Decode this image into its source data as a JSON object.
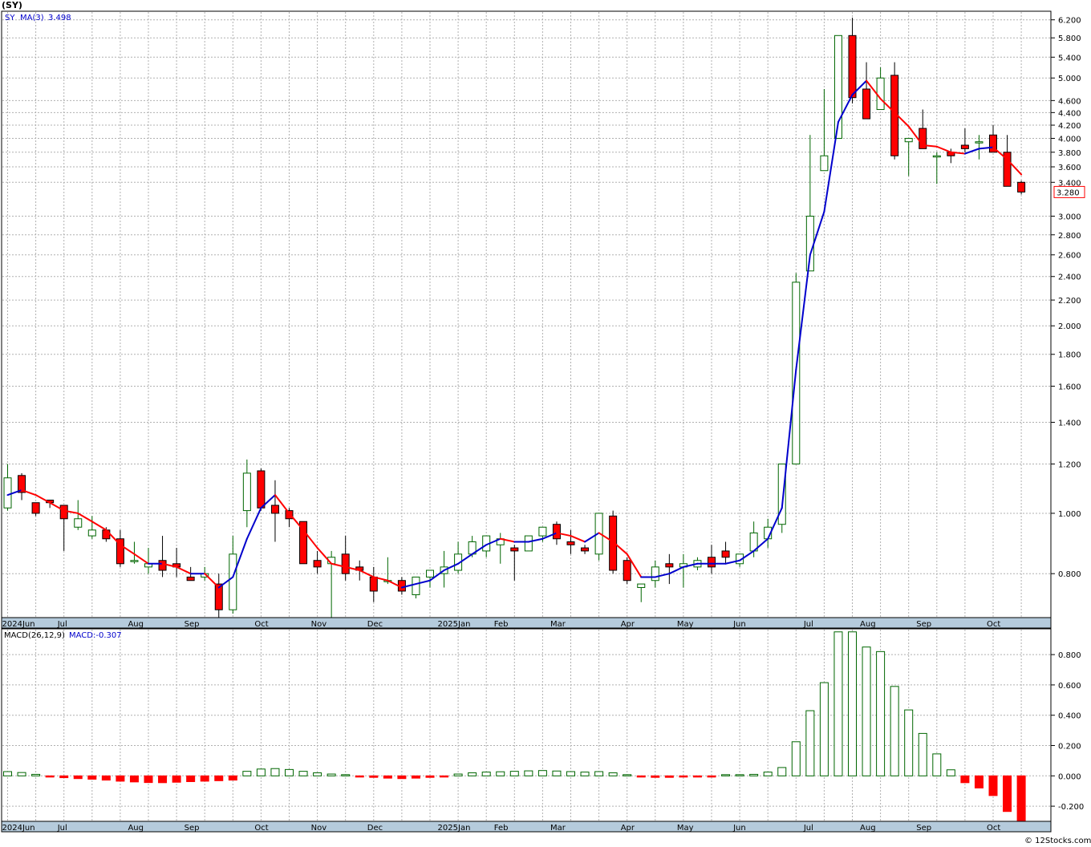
{
  "header": {
    "title": "(SY)"
  },
  "footer": {
    "credit": "© 12Stocks.com"
  },
  "colors": {
    "up": "#006600",
    "down": "#ff0000",
    "ma_up": "#0000cc",
    "ma_down": "#ff0000",
    "grid": "#b0b0b0",
    "axis_band": "#b5cbdc"
  },
  "price_panel": {
    "legend": {
      "symbol": "SY",
      "ma_label": "MA(3)",
      "ma_value": "3.498"
    },
    "last_price": "3.280"
  },
  "macd_panel": {
    "legend": {
      "label": "MACD(26,12,9)",
      "value_label": "MACD:-0.307"
    }
  },
  "x_axis": {
    "month_labels": [
      {
        "label": "2024Jun",
        "week": 0
      },
      {
        "label": "Jul",
        "week": 4
      },
      {
        "label": "Aug",
        "week": 9
      },
      {
        "label": "Sep",
        "week": 13
      },
      {
        "label": "Oct",
        "week": 18
      },
      {
        "label": "Nov",
        "week": 22
      },
      {
        "label": "Dec",
        "week": 26
      },
      {
        "label": "2025Jan",
        "week": 31
      },
      {
        "label": "Feb",
        "week": 35
      },
      {
        "label": "Mar",
        "week": 39
      },
      {
        "label": "Apr",
        "week": 44
      },
      {
        "label": "May",
        "week": 48
      },
      {
        "label": "Jun",
        "week": 52
      },
      {
        "label": "Jul",
        "week": 57
      },
      {
        "label": "Aug",
        "week": 61
      },
      {
        "label": "Sep",
        "week": 65
      },
      {
        "label": "Oct",
        "week": 70
      }
    ]
  },
  "chart_data": [
    {
      "type": "candlestick",
      "title": "(SY)",
      "y_scale": "log",
      "ylim": [
        0.68,
        6.4
      ],
      "y_ticks": [
        0.8,
        1.0,
        1.2,
        1.4,
        1.6,
        1.8,
        2.0,
        2.2,
        2.4,
        2.6,
        2.8,
        3.0,
        3.4,
        3.6,
        3.8,
        4.0,
        4.2,
        4.4,
        4.6,
        5.0,
        5.4,
        5.8,
        6.2
      ],
      "y_tick_labels": [
        "0.800",
        "1.000",
        "1.200",
        "1.400",
        "1.600",
        "1.800",
        "2.000",
        "2.200",
        "2.400",
        "2.600",
        "2.800",
        "3.000",
        "3.400",
        "3.600",
        "3.800",
        "4.000",
        "4.200",
        "4.400",
        "4.600",
        "5.000",
        "5.400",
        "5.800",
        "6.200"
      ],
      "grid": true,
      "series": [
        {
          "name": "SY",
          "candles": [
            [
              1.02,
              1.2,
              1.01,
              1.14
            ],
            [
              1.15,
              1.16,
              1.05,
              1.08
            ],
            [
              1.04,
              1.04,
              0.99,
              1.0
            ],
            [
              1.05,
              1.05,
              1.02,
              1.04
            ],
            [
              1.03,
              1.03,
              0.87,
              0.98
            ],
            [
              0.95,
              1.05,
              0.94,
              0.98
            ],
            [
              0.92,
              0.99,
              0.91,
              0.94
            ],
            [
              0.94,
              0.95,
              0.9,
              0.91
            ],
            [
              0.91,
              0.94,
              0.82,
              0.83
            ],
            [
              0.84,
              0.9,
              0.83,
              0.84
            ],
            [
              0.82,
              0.88,
              0.8,
              0.83
            ],
            [
              0.84,
              0.92,
              0.79,
              0.81
            ],
            [
              0.83,
              0.88,
              0.79,
              0.82
            ],
            [
              0.79,
              0.82,
              0.78,
              0.78
            ],
            [
              0.79,
              0.82,
              0.78,
              0.8
            ],
            [
              0.77,
              0.8,
              0.67,
              0.7
            ],
            [
              0.7,
              0.92,
              0.69,
              0.86
            ],
            [
              1.01,
              1.22,
              0.95,
              1.16
            ],
            [
              1.17,
              1.18,
              1.01,
              1.02
            ],
            [
              1.03,
              1.13,
              0.9,
              1.0
            ],
            [
              1.01,
              1.02,
              0.95,
              0.98
            ],
            [
              0.97,
              0.97,
              0.83,
              0.83
            ],
            [
              0.84,
              0.87,
              0.8,
              0.82
            ],
            [
              0.83,
              0.87,
              0.64,
              0.85
            ],
            [
              0.86,
              0.92,
              0.78,
              0.8
            ],
            [
              0.82,
              0.84,
              0.78,
              0.81
            ],
            [
              0.79,
              0.82,
              0.72,
              0.75
            ],
            [
              0.78,
              0.85,
              0.77,
              0.78
            ],
            [
              0.78,
              0.79,
              0.74,
              0.75
            ],
            [
              0.74,
              0.78,
              0.73,
              0.79
            ],
            [
              0.79,
              0.81,
              0.76,
              0.81
            ],
            [
              0.8,
              0.87,
              0.76,
              0.82
            ],
            [
              0.81,
              0.9,
              0.8,
              0.86
            ],
            [
              0.86,
              0.92,
              0.85,
              0.9
            ],
            [
              0.87,
              0.92,
              0.85,
              0.92
            ],
            [
              0.89,
              0.93,
              0.83,
              0.91
            ],
            [
              0.88,
              0.89,
              0.78,
              0.87
            ],
            [
              0.87,
              0.91,
              0.87,
              0.92
            ],
            [
              0.92,
              0.95,
              0.9,
              0.95
            ],
            [
              0.96,
              0.97,
              0.89,
              0.91
            ],
            [
              0.9,
              0.94,
              0.86,
              0.89
            ],
            [
              0.88,
              0.89,
              0.86,
              0.87
            ],
            [
              0.86,
              1.0,
              0.84,
              1.0
            ],
            [
              0.99,
              1.01,
              0.8,
              0.81
            ],
            [
              0.84,
              0.85,
              0.77,
              0.78
            ],
            [
              0.76,
              0.77,
              0.72,
              0.77
            ],
            [
              0.78,
              0.84,
              0.76,
              0.82
            ],
            [
              0.83,
              0.86,
              0.77,
              0.82
            ],
            [
              0.82,
              0.86,
              0.76,
              0.83
            ],
            [
              0.82,
              0.85,
              0.81,
              0.84
            ],
            [
              0.85,
              0.89,
              0.8,
              0.82
            ],
            [
              0.87,
              0.9,
              0.83,
              0.85
            ],
            [
              0.83,
              0.85,
              0.82,
              0.86
            ],
            [
              0.87,
              0.97,
              0.85,
              0.93
            ],
            [
              0.91,
              0.98,
              0.88,
              0.95
            ],
            [
              0.96,
              1.15,
              0.93,
              1.2
            ],
            [
              1.2,
              2.43,
              1.2,
              2.35
            ],
            [
              2.45,
              4.05,
              2.45,
              3.0
            ],
            [
              3.55,
              4.8,
              3.55,
              3.75
            ],
            [
              4.0,
              5.85,
              4.0,
              5.85
            ],
            [
              5.85,
              6.25,
              4.55,
              4.65
            ],
            [
              4.8,
              5.3,
              4.3,
              4.3
            ],
            [
              4.45,
              5.2,
              4.45,
              5.0
            ],
            [
              5.05,
              5.3,
              3.7,
              3.75
            ],
            [
              3.95,
              4.0,
              3.48,
              4.0
            ],
            [
              4.15,
              4.45,
              3.85,
              3.85
            ],
            [
              3.75,
              3.8,
              3.38,
              3.75
            ],
            [
              3.8,
              3.85,
              3.65,
              3.75
            ],
            [
              3.9,
              4.15,
              3.8,
              3.85
            ],
            [
              3.95,
              4.05,
              3.7,
              3.95
            ],
            [
              4.05,
              4.2,
              3.8,
              3.8
            ],
            [
              3.8,
              4.05,
              3.35,
              3.35
            ],
            [
              3.4,
              3.42,
              3.25,
              3.28
            ]
          ]
        },
        {
          "name": "MA(3)",
          "values": [
            1.07,
            1.09,
            1.07,
            1.04,
            1.01,
            1.0,
            0.97,
            0.94,
            0.89,
            0.86,
            0.83,
            0.83,
            0.82,
            0.8,
            0.8,
            0.76,
            0.79,
            0.91,
            1.02,
            1.07,
            1.0,
            0.94,
            0.88,
            0.83,
            0.82,
            0.81,
            0.79,
            0.78,
            0.76,
            0.77,
            0.78,
            0.81,
            0.83,
            0.86,
            0.89,
            0.91,
            0.9,
            0.9,
            0.91,
            0.93,
            0.92,
            0.9,
            0.93,
            0.9,
            0.86,
            0.79,
            0.79,
            0.8,
            0.82,
            0.83,
            0.83,
            0.83,
            0.84,
            0.87,
            0.91,
            1.02,
            1.7,
            2.6,
            3.05,
            4.25,
            4.7,
            4.95,
            4.63,
            4.4,
            4.18,
            3.9,
            3.88,
            3.8,
            3.78,
            3.85,
            3.87,
            3.7,
            3.5
          ]
        }
      ]
    },
    {
      "type": "bar",
      "title": "MACD(26,12,9)",
      "ylim": [
        -0.3,
        0.97
      ],
      "y_ticks": [
        -0.2,
        0.0,
        0.2,
        0.4,
        0.6,
        0.8
      ],
      "y_tick_labels": [
        "-0.200",
        "0.000",
        "0.200",
        "0.400",
        "0.600",
        "0.800"
      ],
      "grid": true,
      "series": [
        {
          "name": "MACD",
          "values": [
            0.028,
            0.022,
            0.01,
            -0.005,
            -0.012,
            -0.018,
            -0.022,
            -0.028,
            -0.035,
            -0.04,
            -0.044,
            -0.045,
            -0.042,
            -0.038,
            -0.035,
            -0.032,
            -0.028,
            0.03,
            0.045,
            0.048,
            0.042,
            0.03,
            0.02,
            0.012,
            0.005,
            -0.005,
            -0.01,
            -0.015,
            -0.018,
            -0.015,
            -0.01,
            -0.003,
            0.012,
            0.02,
            0.025,
            0.027,
            0.03,
            0.033,
            0.035,
            0.032,
            0.028,
            0.025,
            0.028,
            0.02,
            0.003,
            -0.008,
            -0.01,
            -0.01,
            -0.008,
            -0.005,
            -0.003,
            0.0,
            0.003,
            0.01,
            0.025,
            0.055,
            0.225,
            0.43,
            0.615,
            0.95,
            0.95,
            0.85,
            0.82,
            0.59,
            0.435,
            0.28,
            0.145,
            0.04,
            -0.045,
            -0.08,
            -0.13,
            -0.235,
            -0.307
          ]
        }
      ]
    }
  ]
}
